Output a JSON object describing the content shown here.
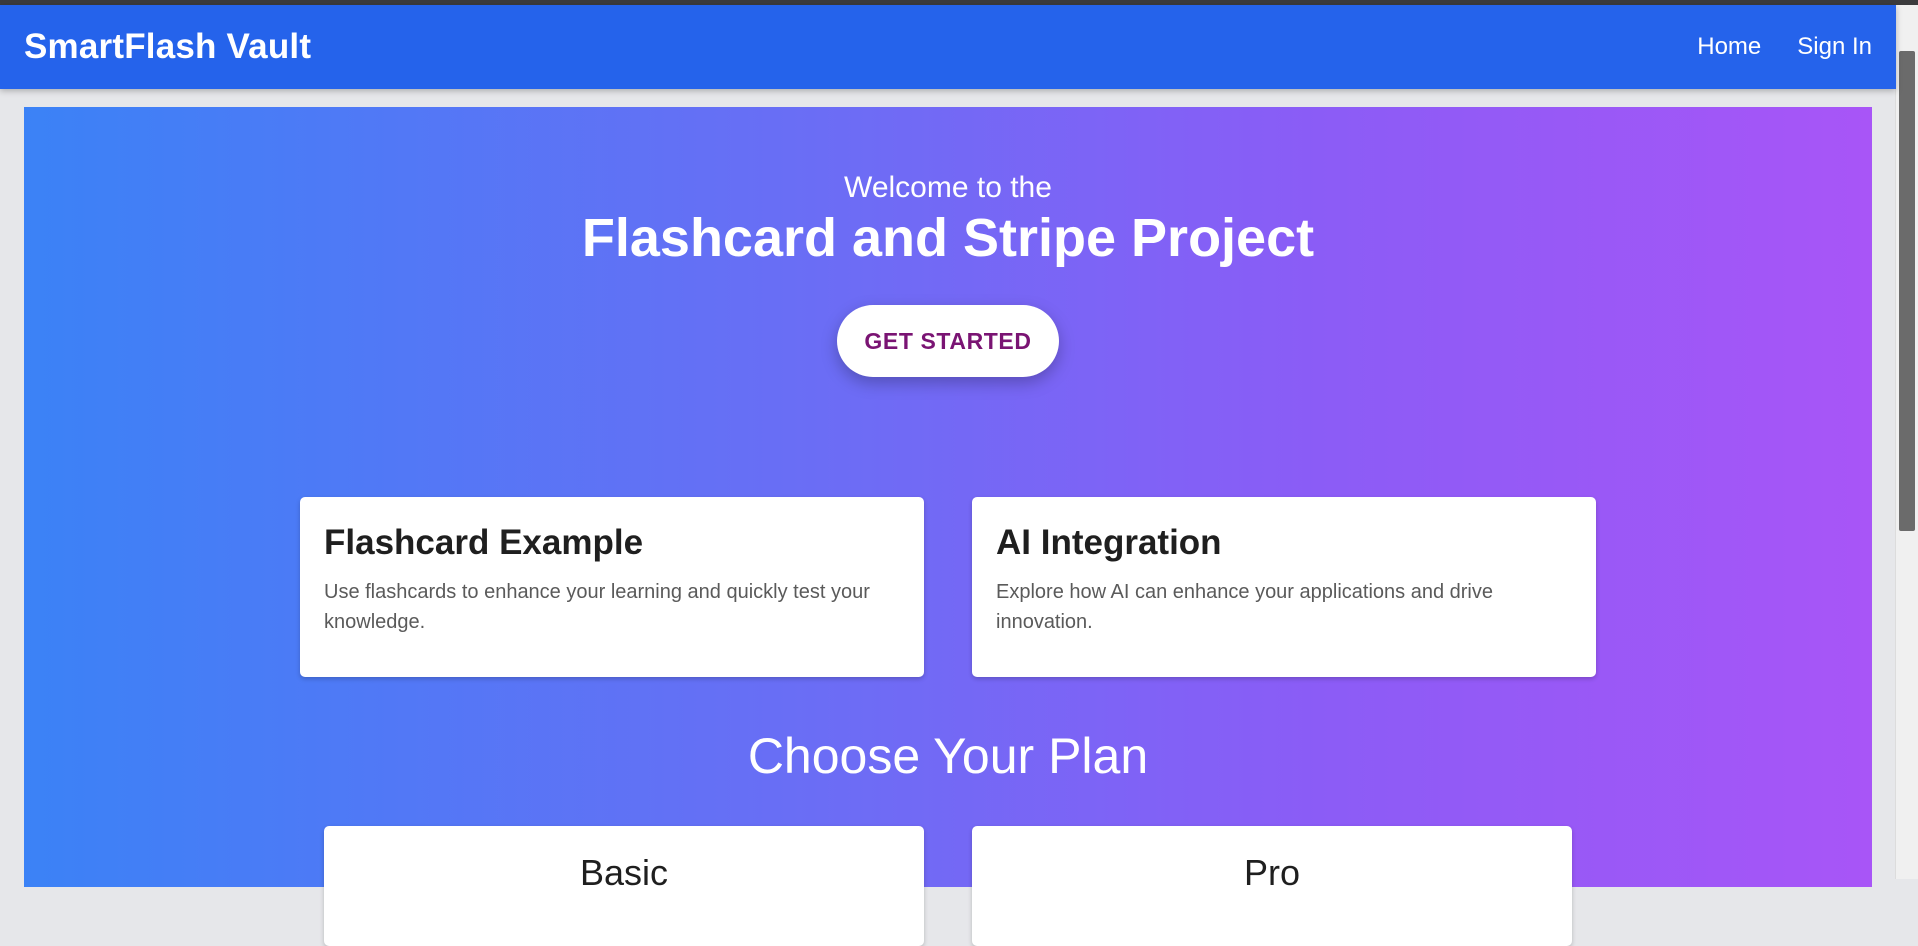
{
  "appbar": {
    "brand": "SmartFlash Vault",
    "nav": [
      "Home",
      "Sign In"
    ]
  },
  "hero": {
    "welcome": "Welcome to the",
    "headline": "Flashcard and Stripe Project",
    "cta": "GET STARTED"
  },
  "features": [
    {
      "title": "Flashcard Example",
      "description": "Use flashcards to enhance your learning and quickly test your knowledge."
    },
    {
      "title": "AI Integration",
      "description": "Explore how AI can enhance your applications and drive innovation."
    }
  ],
  "plans": {
    "title": "Choose Your Plan",
    "items": [
      {
        "name": "Basic"
      },
      {
        "name": "Pro"
      }
    ]
  },
  "colors": {
    "appbar": "#2563eb",
    "gradient_start": "#3b82f6",
    "gradient_end": "#a855f7",
    "cta_text": "#7a1473"
  }
}
